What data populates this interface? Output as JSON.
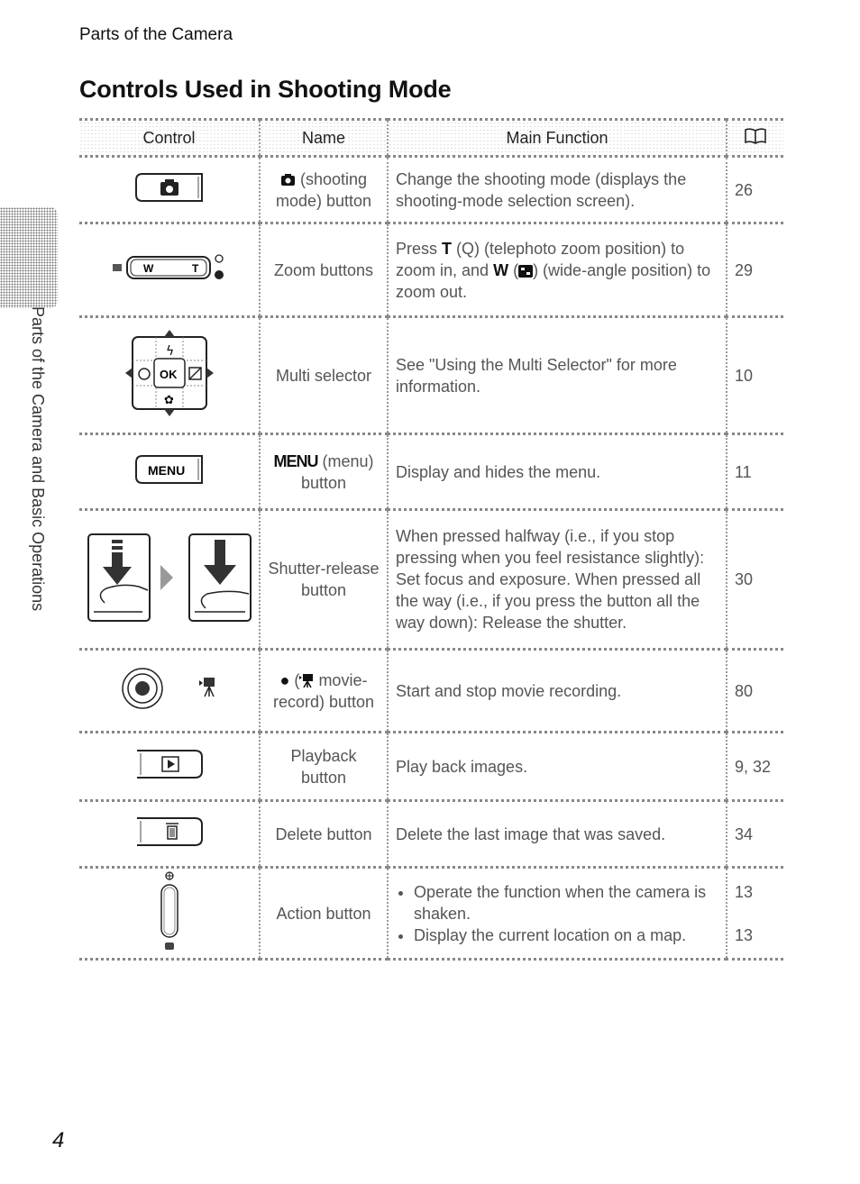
{
  "running_head": "Parts of the Camera",
  "title": "Controls Used in Shooting Mode",
  "side_label": "Parts of the Camera and Basic Operations",
  "page_number": "4",
  "table": {
    "headers": {
      "control": "Control",
      "name": "Name",
      "function": "Main Function",
      "reference_icon": "book-icon"
    },
    "rows": [
      {
        "control_icon": "shooting-mode-button-icon",
        "name_prefix_icon": "camera-icon",
        "name": "(shooting mode) button",
        "function": "Change the shooting mode (displays the shooting-mode selection screen).",
        "ref": "26"
      },
      {
        "control_icon": "zoom-buttons-icon",
        "name": "Zoom buttons",
        "function_parts": {
          "p1": "Press ",
          "t_key": "T",
          "p2": " (",
          "t_icon": "Q",
          "p3": ") (telephoto zoom position) to zoom in, and ",
          "w_key": "W",
          "p4": " (",
          "p5": ") (wide-angle position) to zoom out."
        },
        "ref": "29"
      },
      {
        "control_icon": "multi-selector-icon",
        "name": "Multi selector",
        "function": "See \"Using the Multi Selector\" for more information.",
        "ref": "10"
      },
      {
        "control_icon": "menu-button-icon",
        "name_key": "MENU",
        "name": "(menu) button",
        "function": "Display and hides the menu.",
        "ref": "11"
      },
      {
        "control_icon": "shutter-release-icon",
        "name": "Shutter-release button",
        "function": "When pressed halfway (i.e., if you stop pressing when you feel resistance slightly): Set focus and exposure. When pressed all the way (i.e., if you press the button all the way down): Release the shutter.",
        "ref": "30"
      },
      {
        "control_icon": "movie-record-button-icon",
        "name_prefix": "●",
        "name": "movie-record) button",
        "function": "Start and stop movie recording.",
        "ref": "80"
      },
      {
        "control_icon": "playback-button-icon",
        "name": "Playback button",
        "function": "Play back images.",
        "ref": "9, 32"
      },
      {
        "control_icon": "delete-button-icon",
        "name": "Delete button",
        "function": "Delete the last image that was saved.",
        "ref": "34"
      },
      {
        "control_icon": "action-button-icon",
        "name": "Action button",
        "bullets": [
          {
            "text": "Operate the function when the camera is shaken.",
            "ref": "13"
          },
          {
            "text": "Display the current location on a map.",
            "ref": "13"
          }
        ]
      }
    ]
  }
}
